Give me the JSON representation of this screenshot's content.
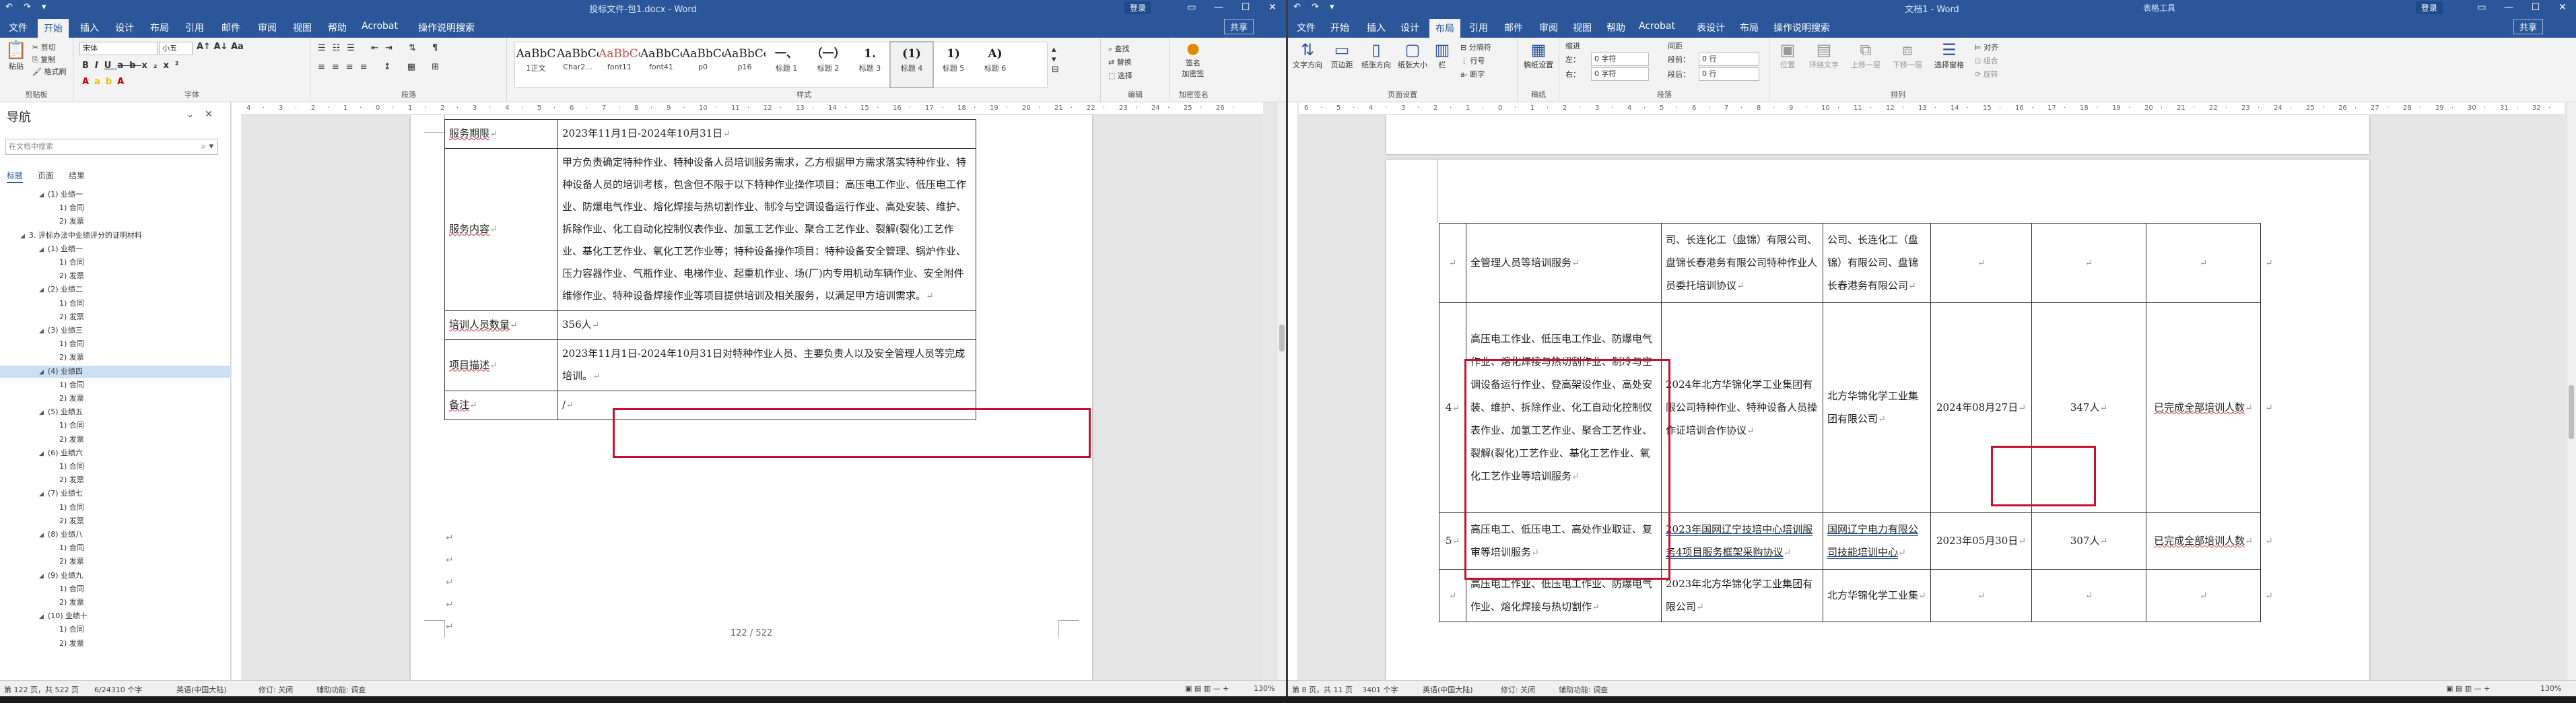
{
  "left": {
    "title": "投标文件-包1.docx - Word",
    "account": "登录",
    "tabs": [
      "文件",
      "开始",
      "插入",
      "设计",
      "布局",
      "引用",
      "邮件",
      "审阅",
      "视图",
      "帮助",
      "Acrobat",
      "操作说明搜索"
    ],
    "active_tab_index": 1,
    "share": "共享",
    "clipboard": {
      "paste": "粘贴",
      "cut": "剪切",
      "copy": "复制",
      "painter": "格式刷",
      "label": "剪贴板"
    },
    "font": {
      "name": "宋体",
      "size": "小五",
      "label": "字体"
    },
    "paragraph_label": "段落",
    "styles": [
      {
        "preview": "AaBbC",
        "name": "1正文"
      },
      {
        "preview": "AaBbCcDd",
        "name": "Char2..."
      },
      {
        "preview": "AaBbCcDd",
        "name": "font11"
      },
      {
        "preview": "AaBbCcDc",
        "name": "font41"
      },
      {
        "preview": "AaBbCcDc",
        "name": "p0"
      },
      {
        "preview": "AaBbCcD",
        "name": "p16"
      },
      {
        "preview": "一、",
        "name": "标题 1"
      },
      {
        "preview": "（一）",
        "name": "标题 2"
      },
      {
        "preview": "1.",
        "name": "标题 3"
      },
      {
        "preview": "(1)",
        "name": "标题 4"
      },
      {
        "preview": "1)",
        "name": "标题 5"
      },
      {
        "preview": "A)",
        "name": "标题 6"
      }
    ],
    "styles_label": "样式",
    "editing": {
      "find": "查找",
      "replace": "替换",
      "select": "选择",
      "label": "编辑"
    },
    "acrobat": {
      "sign": "签名",
      "sign2": "加密签",
      "label": "加密签名"
    },
    "nav": {
      "title": "导航",
      "search_placeholder": "在文档中搜索",
      "tabs": [
        "标题",
        "页面",
        "结果"
      ],
      "items": [
        {
          "t": "(1) 业绩一",
          "lvl": 2,
          "tw": "◢"
        },
        {
          "t": "1) 合同",
          "lvl": 3,
          "tw": ""
        },
        {
          "t": "2) 发票",
          "lvl": 3,
          "tw": ""
        },
        {
          "t": "3. 评标办法中业绩评分的证明材料",
          "lvl": 1,
          "tw": "◢"
        },
        {
          "t": "(1) 业绩一",
          "lvl": 2,
          "tw": "◢"
        },
        {
          "t": "1) 合同",
          "lvl": 3,
          "tw": ""
        },
        {
          "t": "2) 发票",
          "lvl": 3,
          "tw": ""
        },
        {
          "t": "(2) 业绩二",
          "lvl": 2,
          "tw": "◢"
        },
        {
          "t": "1) 合同",
          "lvl": 3,
          "tw": ""
        },
        {
          "t": "2) 发票",
          "lvl": 3,
          "tw": ""
        },
        {
          "t": "(3) 业绩三",
          "lvl": 2,
          "tw": "◢"
        },
        {
          "t": "1) 合同",
          "lvl": 3,
          "tw": ""
        },
        {
          "t": "2) 发票",
          "lvl": 3,
          "tw": ""
        },
        {
          "t": "(4) 业绩四",
          "lvl": 2,
          "tw": "◢",
          "sel": true
        },
        {
          "t": "1) 合同",
          "lvl": 3,
          "tw": ""
        },
        {
          "t": "2) 发票",
          "lvl": 3,
          "tw": ""
        },
        {
          "t": "(5) 业绩五",
          "lvl": 2,
          "tw": "◢"
        },
        {
          "t": "1) 合同",
          "lvl": 3,
          "tw": ""
        },
        {
          "t": "2) 发票",
          "lvl": 3,
          "tw": ""
        },
        {
          "t": "(6) 业绩六",
          "lvl": 2,
          "tw": "◢"
        },
        {
          "t": "1) 合同",
          "lvl": 3,
          "tw": ""
        },
        {
          "t": "2) 发票",
          "lvl": 3,
          "tw": ""
        },
        {
          "t": "(7) 业绩七",
          "lvl": 2,
          "tw": "◢"
        },
        {
          "t": "1) 合同",
          "lvl": 3,
          "tw": ""
        },
        {
          "t": "2) 发票",
          "lvl": 3,
          "tw": ""
        },
        {
          "t": "(8) 业绩八",
          "lvl": 2,
          "tw": "◢"
        },
        {
          "t": "1) 合同",
          "lvl": 3,
          "tw": ""
        },
        {
          "t": "2) 发票",
          "lvl": 3,
          "tw": ""
        },
        {
          "t": "(9) 业绩九",
          "lvl": 2,
          "tw": "◢"
        },
        {
          "t": "1) 合同",
          "lvl": 3,
          "tw": ""
        },
        {
          "t": "2) 发票",
          "lvl": 3,
          "tw": ""
        },
        {
          "t": "(10) 业绩十",
          "lvl": 2,
          "tw": "◢"
        },
        {
          "t": "1) 合同",
          "lvl": 3,
          "tw": ""
        },
        {
          "t": "2) 发票",
          "lvl": 3,
          "tw": ""
        }
      ]
    },
    "table": [
      {
        "label": "服务期限",
        "value": "2023年11月1日-2024年10月31日"
      },
      {
        "label": "服务内容",
        "value": "甲方负责确定特种作业、特种设备人员培训服务需求，乙方根据甲方需求落实特种作业、特种设备人员的培训考核，包含但不限于以下特种作业操作项目：高压电工作业、低压电工作业、防爆电气作业、熔化焊接与热切割作业、制冷与空调设备运行作业、高处安装、维护、拆除作业、化工自动化控制仪表作业、加氢工艺作业、聚合工艺作业、裂解(裂化)工艺作业、基化工艺作业、氧化工艺作业等；特种设备操作项目：特种设备安全管理、锅炉作业、压力容器作业、气瓶作业、电梯作业、起重机作业、场(厂)内专用机动车辆作业、安全附件维修作业、特种设备焊接作业等项目提供培训及相关服务，以满足甲方培训需求。"
      },
      {
        "label": "培训人员数量",
        "value": "356人"
      },
      {
        "label": "项目描述",
        "value": "2023年11月1日-2024年10月31日对特种作业人员、主要负责人以及安全管理人员等完成培训。"
      },
      {
        "label": "备注",
        "value": "/"
      }
    ],
    "page_counter": "122 / 522",
    "status": {
      "page": "第 122 页，共 522 页",
      "words": "6/24310 个字",
      "lang": "英语(中国大陆)",
      "track": "修订: 关闭",
      "access": "辅助功能: 调查",
      "zoom": "130%"
    }
  },
  "right": {
    "title": "文档1 - Word",
    "context_tab": "表格工具",
    "account": "登录",
    "tabs": [
      "文件",
      "开始",
      "插入",
      "设计",
      "布局",
      "引用",
      "邮件",
      "审阅",
      "视图",
      "帮助",
      "Acrobat",
      "表设计",
      "布局",
      "操作说明搜索"
    ],
    "active_tab_index": 4,
    "share": "共享",
    "page_setup": {
      "margins": "文字方向",
      "margins2": "页边距",
      "orient": "纸张方向",
      "size": "纸张大小",
      "cols": "栏",
      "breaks": "分隔符",
      "lines": "行号",
      "hyph": "断字",
      "label": "页面设置"
    },
    "paragraph": {
      "indent": "缩进",
      "spacing": "间距",
      "left": "左：",
      "right": "右：",
      "before": "段前：",
      "after": "段后：",
      "left_val": "0 字符",
      "right_val": "0 字符",
      "before_val": "0 行",
      "after_val": "0 行",
      "label": "段落"
    },
    "arrange": {
      "position": "位置",
      "wrap": "环绕文字",
      "forward": "上移一层",
      "backward": "下移一层",
      "pane": "选择窗格",
      "align": "对齐",
      "group": "组合",
      "rotate": "旋转",
      "label": "排列"
    },
    "manuscript": {
      "grid": "稿纸设置",
      "label": "稿纸"
    },
    "table": [
      {
        "no": "",
        "c1": "全管理人员等培训服务",
        "c2": "司、长连化工（盘锦）有限公司、盘锦长春港务有限公司特种作业人员委托培训协议",
        "c3": "公司、长连化工（盘锦）有限公司、盘锦长春港务有限公司",
        "c4": "",
        "c5": "",
        "c6": ""
      },
      {
        "no": "4",
        "c1": "高压电工作业、低压电工作业、防爆电气作业、熔化焊接与热切割作业、制冷与空调设备运行作业、登高架设作业、高处安装、维护、拆除作业、化工自动化控制仪表作业、加氢工艺作业、聚合工艺作业、裂解(裂化)工艺作业、基化工艺作业、氧化工艺作业等培训服务",
        "c2": "2024年北方华锦化学工业集团有限公司特种作业、特种设备人员操作证培训合作协议",
        "c3": "北方华锦化学工业集团有限公司",
        "c4": "2024年08月27日",
        "c5": "347人",
        "c6": "已完成全部培训人数"
      },
      {
        "no": "5",
        "c1": "高压电工、低压电工、高处作业取证、复审等培训服务",
        "c2": "2023年国网辽宁技培中心培训服务4项目服务框架采购协议",
        "c3": "国网辽宁电力有限公司技能培训中心",
        "c4": "2023年05月30日",
        "c5": "307人",
        "c6": "已完成全部培训人数"
      },
      {
        "no": "",
        "c1": "高压电工作业、低压电工作业、防爆电气作业、熔化焊接与热切割作",
        "c2": "2023年北方华锦化学工业集团有限公司",
        "c3": "北方华锦化学工业集",
        "c4": "",
        "c5": "",
        "c6": ""
      }
    ],
    "status": {
      "page": "第 8 页，共 11 页",
      "words": "3401 个字",
      "lang": "英语(中国大陆)",
      "track": "修订: 关闭",
      "access": "辅助功能: 调查",
      "zoom": "130%"
    }
  }
}
